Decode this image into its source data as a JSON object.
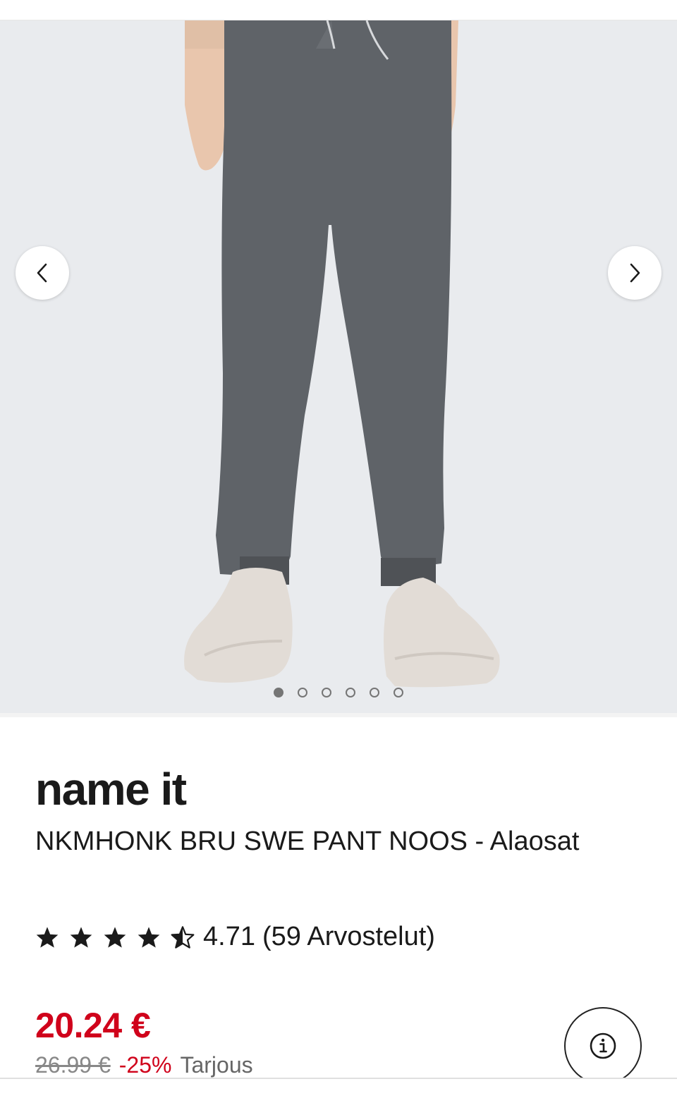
{
  "gallery": {
    "image_alt": "",
    "slide_count": 6,
    "active_slide": 0,
    "prev_icon": "chevron-left-icon",
    "next_icon": "chevron-right-icon"
  },
  "product": {
    "brand": "name it",
    "name": "NKMHONK BRU SWE PANT NOOS - Alaosat",
    "rating": {
      "stars": 4.5,
      "value": "4.71",
      "reviews": "(59 Arvostelut)"
    },
    "price": {
      "current": "20.24 €",
      "original": "26.99 €",
      "discount": "-25%",
      "label": "Tarjous"
    },
    "info_icon": "info-icon"
  },
  "colors": {
    "price_red": "#d0021b",
    "text": "#1a1a1a",
    "gallery_bg": "#e9ebee",
    "pants": "#5f6368"
  }
}
